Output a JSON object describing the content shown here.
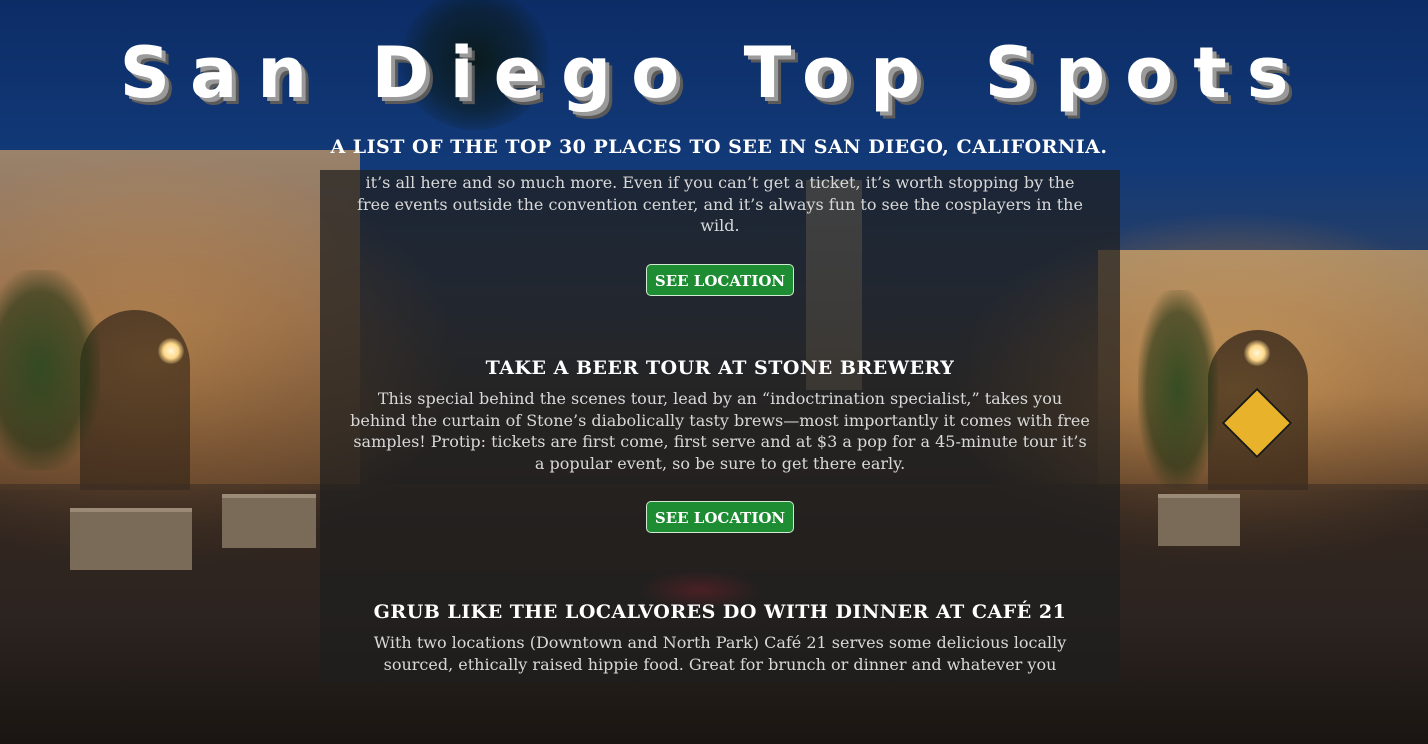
{
  "site": {
    "title": "San Diego Top Spots",
    "subtitle": "A list of the top 30 places to see in San Diego, California."
  },
  "spots": [
    {
      "name": "",
      "description": "it’s all here and so much more. Even if you can’t get a ticket, it’s worth stopping by the free events outside the convention center, and it’s always fun to see the cosplayers in the wild.",
      "button_label": "See Location"
    },
    {
      "name": "Take a Beer Tour at Stone Brewery",
      "description": "This special behind the scenes tour, lead by an “indoctrination specialist,” takes you behind the curtain of Stone’s diabolically tasty brews—most importantly it comes with free samples! Protip: tickets are first come, first serve and at $3 a pop for a 45-minute tour it’s a popular event, so be sure to get there early.",
      "button_label": "See Location"
    },
    {
      "name": "Grub like the Localvores do with dinner at Café 21",
      "description": "With two locations (Downtown and North Park) Café 21 serves some delicious locally sourced, ethically raised hippie food. Great for brunch or dinner and whatever you",
      "button_label": ""
    }
  ],
  "colors": {
    "button_bg": "#1e8c32",
    "panel_bg": "rgba(30,30,30,0.72)"
  }
}
